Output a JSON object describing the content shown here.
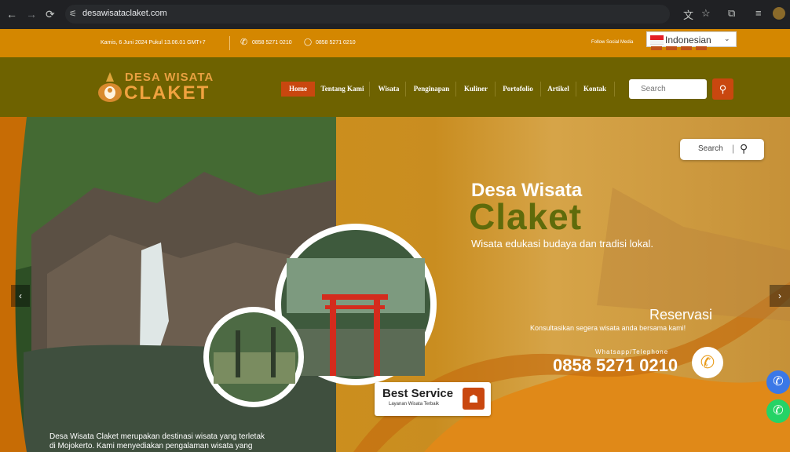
{
  "browser": {
    "url": "desawisataclaket.com",
    "icons": [
      "back-icon",
      "forward-icon",
      "reload-icon",
      "site-info-icon",
      "translate-icon",
      "star-icon",
      "extensions-icon",
      "reading-list-icon",
      "profile-icon"
    ]
  },
  "topbar": {
    "datetime": "Kamis, 6 Juni 2024 Pukul 13.06.01 GMT+7",
    "phone": "0858 5271 0210",
    "whatsapp": "0858 5271 0210",
    "follow_label": "Follow Social Media",
    "language": "Indonesian"
  },
  "header": {
    "logo_line1": "DESA WISATA",
    "logo_line2": "CLAKET",
    "menu": [
      "Home",
      "Tentang Kami",
      "Wisata",
      "Penginapan",
      "Kuliner",
      "Portofolio",
      "Artikel",
      "Kontak"
    ],
    "search_placeholder": "Search"
  },
  "hero": {
    "search_label": "Search",
    "title_line1": "Desa Wisata",
    "title_line2": "Claket",
    "tagline": "Wisata edukasi budaya dan tradisi lokal.",
    "reservasi_title": "Reservasi",
    "reservasi_sub": "Konsultasikan segera wisata anda bersama kami!",
    "contact_label": "Whatsapp/Telephone",
    "contact_number": "0858 5271 0210",
    "badge_title": "Best Service",
    "badge_sub": "Layanan Wisata Terbaik",
    "description_line1": "Desa Wisata Claket merupakan destinasi wisata yang terletak",
    "description_line2": "di Mojokerto. Kami menyediakan pengalaman wisata yang"
  },
  "colors": {
    "topbar": "#d48700",
    "header": "#6e6200",
    "accent": "#c9470f",
    "title_green": "#5f6b0b",
    "whatsapp": "#25d366"
  }
}
